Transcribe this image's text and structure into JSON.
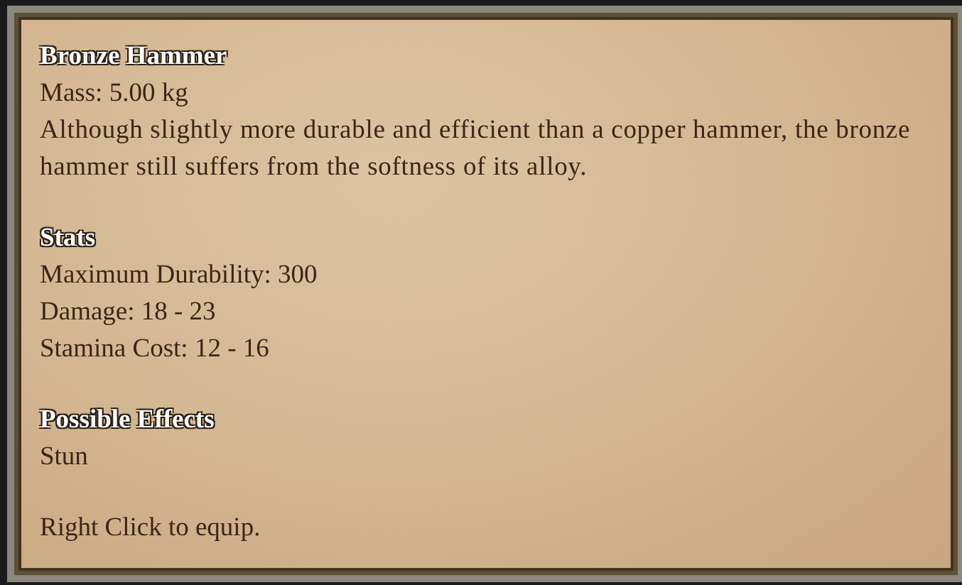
{
  "tooltip": {
    "title": "Bronze Hammer",
    "mass": "Mass: 5.00 kg",
    "description": "Although slightly more durable and efficient than a copper hammer, the bronze hammer still suffers from the softness of its alloy.",
    "sections": [
      {
        "heading": "Stats",
        "lines": [
          "Maximum Durability: 300",
          "Damage: 18 - 23",
          "Stamina Cost: 12 - 16"
        ]
      },
      {
        "heading": "Possible Effects",
        "lines": [
          "Stun"
        ]
      }
    ],
    "hint": "Right Click to equip."
  }
}
